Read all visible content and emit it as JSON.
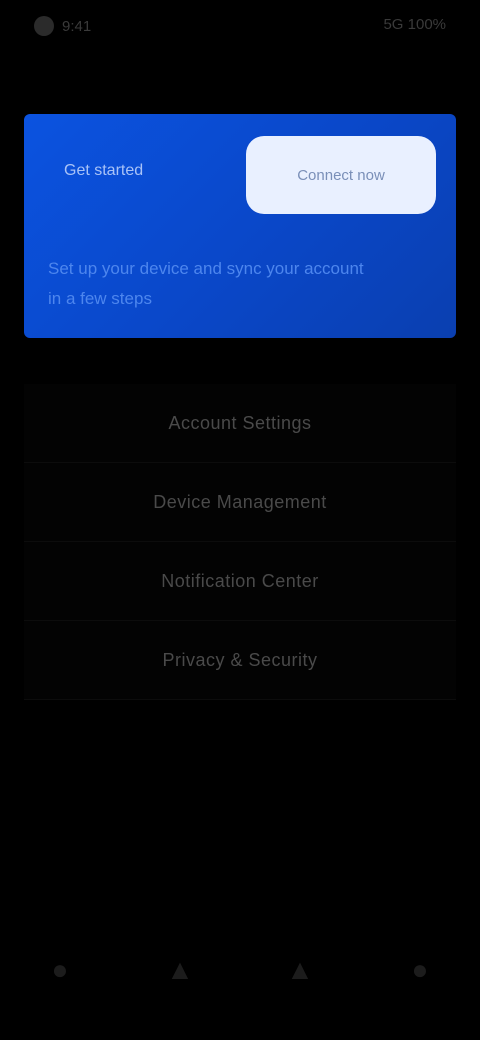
{
  "status_bar": {
    "time": "9:41",
    "indicators": "5G 100%"
  },
  "hero": {
    "title": "Get started",
    "button_label": "Connect now",
    "description": "Set up your device and sync your account in a few steps"
  },
  "menu": {
    "items": [
      {
        "label": "Account Settings"
      },
      {
        "label": "Device Management"
      },
      {
        "label": "Notification Center"
      },
      {
        "label": "Privacy & Security"
      }
    ]
  },
  "bottom_nav": {
    "items": [
      {
        "icon": "home-icon",
        "glyph": "●"
      },
      {
        "icon": "stats-icon",
        "glyph": "▲"
      },
      {
        "icon": "bell-icon",
        "glyph": "▲"
      },
      {
        "icon": "profile-icon",
        "glyph": "●"
      }
    ]
  },
  "colors": {
    "background": "#000000",
    "accent": "#0b53e0",
    "button_bg": "#e9f0ff"
  }
}
